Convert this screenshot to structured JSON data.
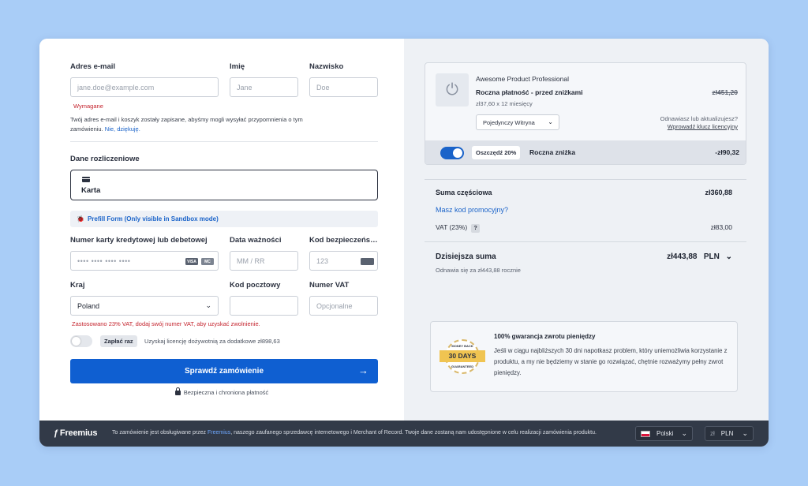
{
  "form": {
    "email_label": "Adres e-mail",
    "email_placeholder": "jane.doe@example.com",
    "first_name_label": "Imię",
    "first_name_placeholder": "Jane",
    "last_name_label": "Nazwisko",
    "last_name_placeholder": "Doe",
    "required_error": "Wymagane",
    "cart_saved_note": "Twój adres e-mail i koszyk zostały zapisane, abyśmy mogli wysyłać przypomnienia o tym",
    "cart_saved_note_2": "zamówieniu.",
    "no_thanks": "Nie, dziękuję.",
    "billing_heading": "Dane rozliczeniowe",
    "method_label": "Karta",
    "prefill_label": "Prefill Form (Only visible in Sandbox mode)",
    "card_number_label": "Numer karty kredytowej lub debetowej",
    "card_number_placeholder": "•••• •••• •••• ••••",
    "expiry_label": "Data ważności",
    "expiry_placeholder": "MM / RR",
    "cvc_label": "Kod bezpieczeńs…",
    "cvc_placeholder": "123",
    "country_label": "Kraj",
    "country_value": "Poland",
    "postal_label": "Kod pocztowy",
    "vat_label": "Numer VAT",
    "vat_placeholder": "Opcjonalne",
    "vat_note": "Zastosowano 23% VAT, dodaj swój numer VAT, aby uzyskać zwolnienie.",
    "pay_once_chip": "Zapłać raz",
    "lifetime_text": "Uzyskaj licencję dożywotnią za dodatkowe zł898,63",
    "submit_label": "Sprawdź zamówienie",
    "secure_text": "Bezpieczna i chroniona płatność",
    "card_brands": [
      "VISA",
      "MC"
    ]
  },
  "summary": {
    "product_name": "Awesome Product Professional",
    "plan_name": "Roczna płatność - przed zniżkami",
    "plan_detail": "zł37,60 x 12 miesięcy",
    "old_price": "zł451,20",
    "license_select": "Pojedynczy Witryna",
    "renew_question": "Odnawiasz lub aktualizujesz?",
    "enter_key_link": "Wprowadź klucz licencyjny",
    "save_chip": "Oszczędź 20%",
    "discount_label": "Roczna zniżka",
    "discount_value": "-zł90,32",
    "subtotal_label": "Suma częściowa",
    "subtotal_value": "zł360,88",
    "promo_link": "Masz kod promocyjny?",
    "vat_label": "VAT (23%)",
    "vat_help": "?",
    "vat_value": "zł83,00",
    "total_label": "Dzisiejsza suma",
    "total_value": "zł443,88",
    "currency": "PLN",
    "renew_note": "Odnawia się za zł443,88 rocznie"
  },
  "guarantee": {
    "badge_top": "MONEY BACK",
    "badge_days": "30 DAYS",
    "badge_bottom": "GUARANTEED",
    "title": "100% gwarancja zwrotu pieniędzy",
    "body": "Jeśli w ciągu najbliższych 30 dni napotkasz problem, który uniemożliwia korzystanie z produktu, a my nie będziemy w stanie go rozwiązać, chętnie rozważymy pełny zwrot pieniędzy."
  },
  "footer": {
    "logo": "Freemius",
    "note_prefix": "To zamówienie jest obsługiwane przez",
    "note_link": "Freemius",
    "note_suffix": ", naszego zaufanego sprzedawcę internetowego i Merchant of Record. Twoje dane zostaną nam udostępnione w celu realizacji zamówienia produktu.",
    "language": "Polski",
    "currency_symbol": "zł",
    "currency": "PLN"
  },
  "colors": {
    "primary": "#0f5fd1",
    "error": "#c4232d",
    "background": "#a9cdf7",
    "footer": "#323a48"
  }
}
